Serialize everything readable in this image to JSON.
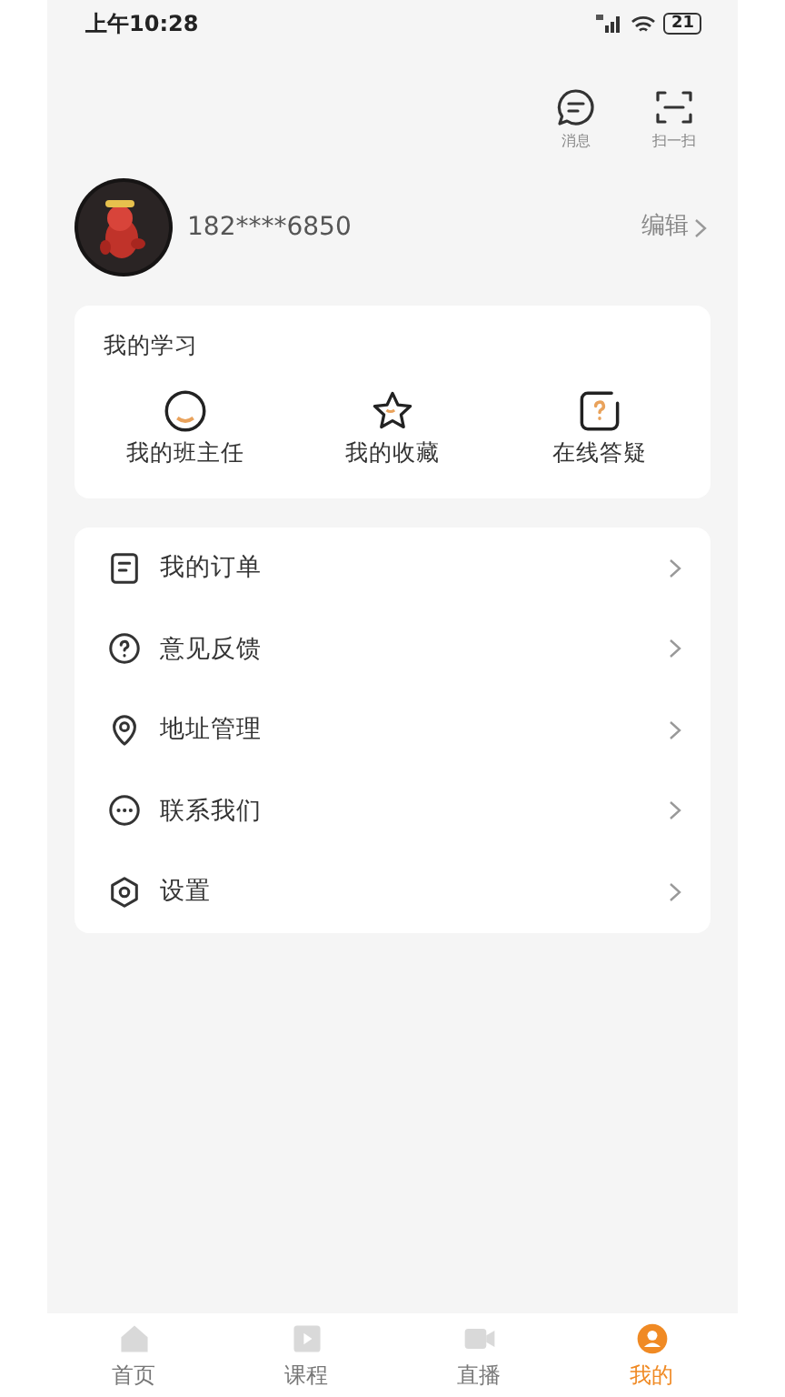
{
  "status_bar": {
    "time": "上午10:28",
    "battery": "21"
  },
  "top_actions": [
    {
      "kind": "message",
      "label": "消息"
    },
    {
      "kind": "scan",
      "label": "扫一扫"
    }
  ],
  "profile": {
    "phone": "182****6850",
    "edit": "编辑"
  },
  "study": {
    "title": "我的学习",
    "items": [
      {
        "kind": "teacher",
        "label": "我的班主任"
      },
      {
        "kind": "star",
        "label": "我的收藏"
      },
      {
        "kind": "question",
        "label": "在线答疑"
      }
    ]
  },
  "menu": [
    {
      "kind": "order",
      "label": "我的订单"
    },
    {
      "kind": "feedback",
      "label": "意见反馈"
    },
    {
      "kind": "address",
      "label": "地址管理"
    },
    {
      "kind": "contact",
      "label": "联系我们"
    },
    {
      "kind": "settings",
      "label": "设置"
    }
  ],
  "tabbar": [
    {
      "kind": "home",
      "label": "首页",
      "selected": false
    },
    {
      "kind": "play",
      "label": "课程",
      "selected": false
    },
    {
      "kind": "live",
      "label": "直播",
      "selected": false
    },
    {
      "kind": "user",
      "label": "我的",
      "selected": true
    }
  ]
}
